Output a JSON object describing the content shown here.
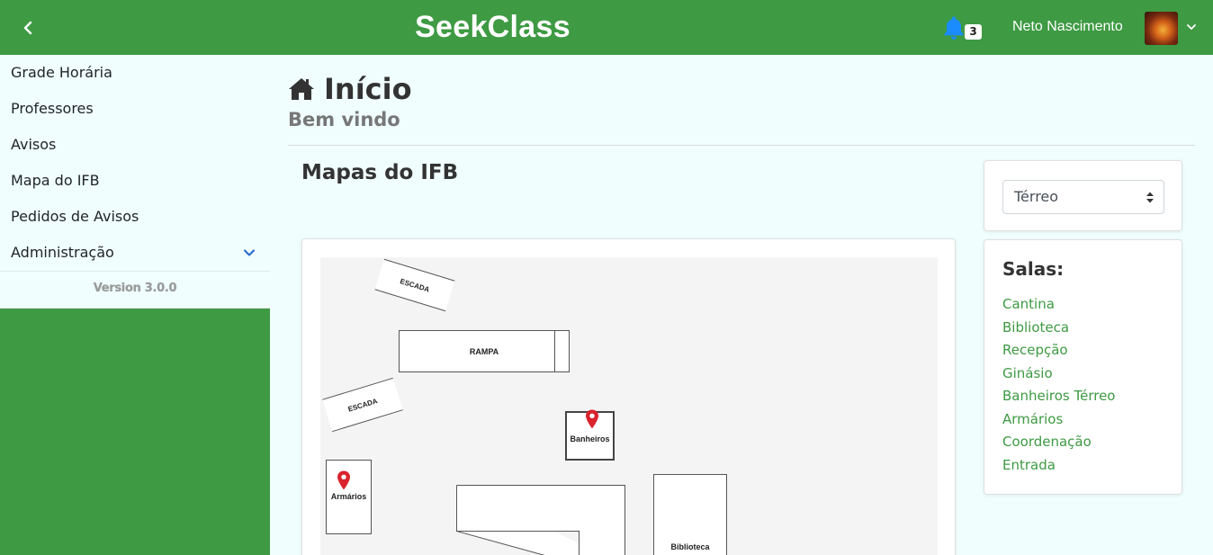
{
  "header": {
    "brand": "SeekClass",
    "notifications_count": "3",
    "user_name": "Neto Nascimento"
  },
  "sidebar": {
    "items": [
      {
        "label": "Grade Horária"
      },
      {
        "label": "Professores"
      },
      {
        "label": "Avisos"
      },
      {
        "label": "Mapa do IFB"
      },
      {
        "label": "Pedidos de Avisos"
      },
      {
        "label": "Administração"
      }
    ],
    "version": "Version 3.0.0"
  },
  "page": {
    "title": "Início",
    "subtitle": "Bem vindo",
    "section_title": "Mapas do IFB"
  },
  "map": {
    "labels": {
      "escada_top": "ESCADA",
      "rampa": "RAMPA",
      "escada_left": "ESCADA",
      "banheiros": "Banheiros",
      "armarios": "Armários",
      "biblioteca": "Biblioteca"
    }
  },
  "floor_select": {
    "value": "Térreo"
  },
  "rooms": {
    "title": "Salas:",
    "items": [
      {
        "label": "Cantina"
      },
      {
        "label": "Biblioteca"
      },
      {
        "label": "Recepção"
      },
      {
        "label": "Ginásio"
      },
      {
        "label": "Banheiros Térreo"
      },
      {
        "label": "Armários"
      },
      {
        "label": "Coordenação"
      },
      {
        "label": "Entrada"
      }
    ]
  },
  "colors": {
    "brand_green": "#3e9a43",
    "bell_blue": "#1a8cff",
    "pin_red": "#d9232d",
    "background": "#f0fefe"
  },
  "icons": {
    "back": "chevron-left-icon",
    "bell": "bell-icon",
    "user_menu": "chevron-down-icon",
    "home": "home-icon",
    "select_arrows": "sort-icon",
    "pin": "map-pin-icon"
  }
}
